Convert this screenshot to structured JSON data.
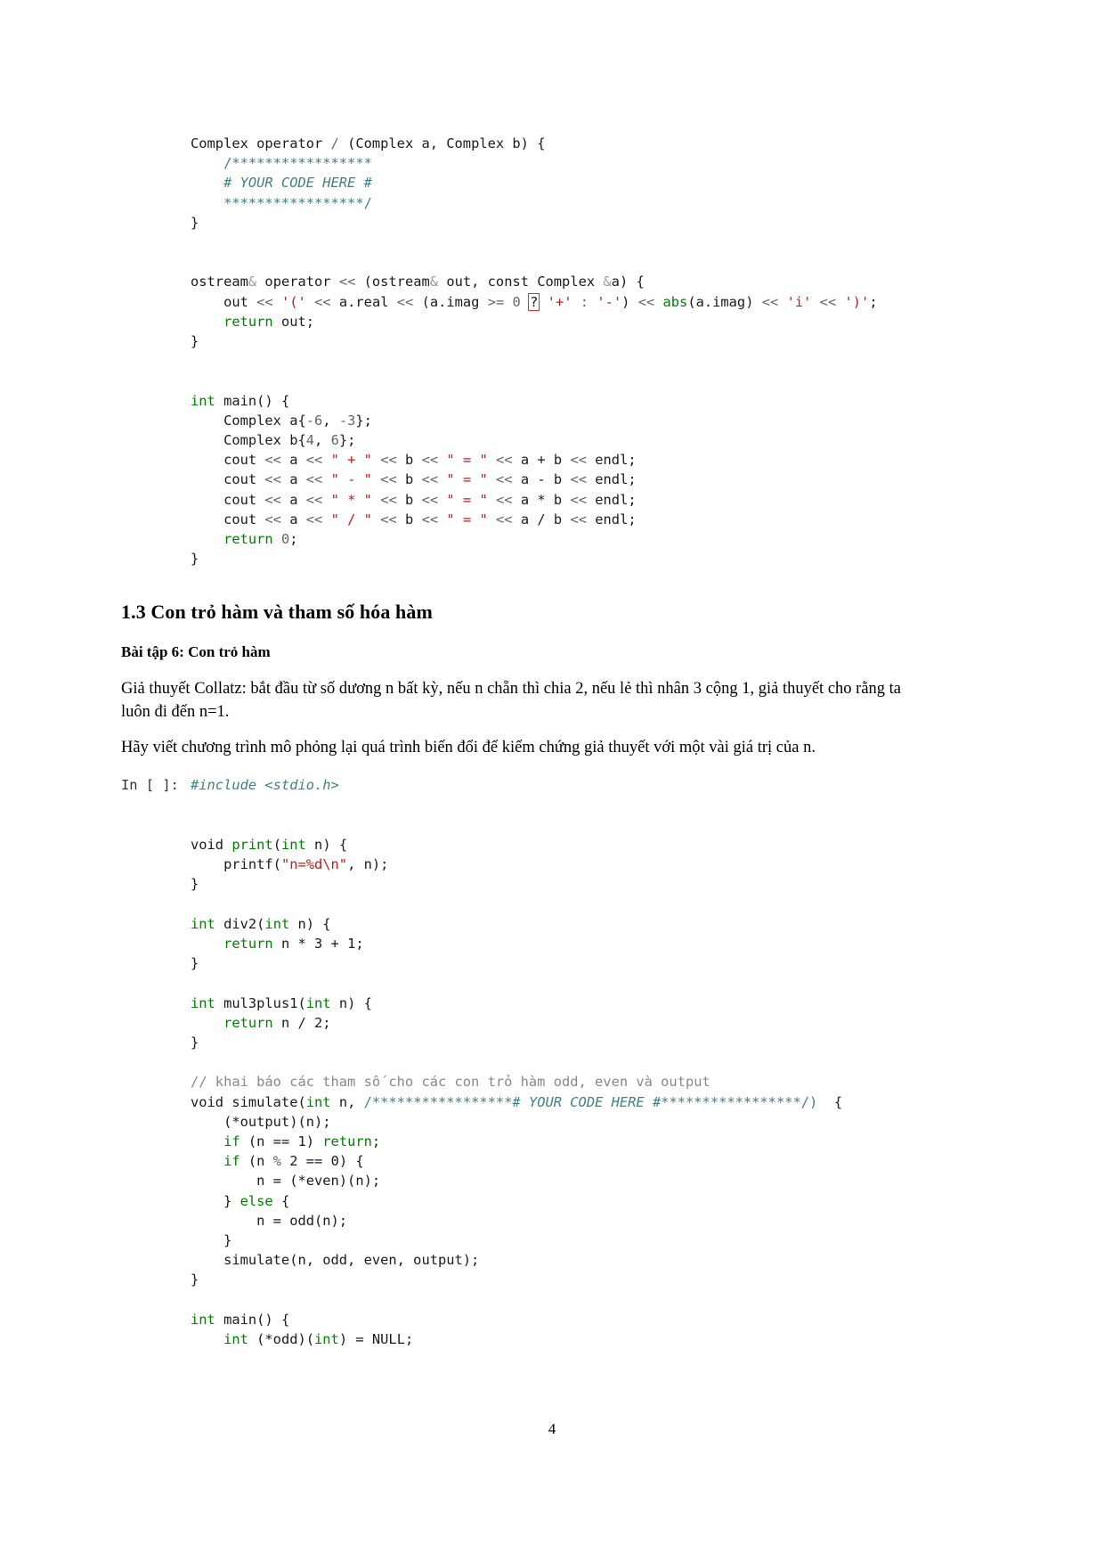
{
  "document": {
    "page_number": "4"
  },
  "code_block_1": {
    "lines": [
      "Complex operator / (Complex a, Complex b) {",
      "    /*****************",
      "    # YOUR CODE HERE #",
      "    *****************/",
      "}"
    ],
    "line1_prefix": "Complex operator ",
    "line1_slash": "/",
    "line1_suffix": " (Complex a, Complex b) {",
    "stars_open": "    /*****************",
    "your_code_here": "    # YOUR CODE HERE #",
    "stars_close": "    *****************/",
    "close_brace": "}"
  },
  "code_block_2": {
    "sig_a": "ostream",
    "sig_amp": "&",
    "sig_b": " operator ",
    "sig_shift": "<<",
    "sig_c": " (ostream",
    "sig_d": " out, const Complex ",
    "sig_e": "a) {",
    "out_indent": "    out ",
    "out_shift1": "<<",
    "out_q_paren": "'('",
    "out_areal": " a.real ",
    "out_paren_open": "(a.imag ",
    "out_gte": ">=",
    "out_zero": "0",
    "out_question": "?",
    "out_plus": "'+'",
    "out_colon": ":",
    "out_minus": "'-'",
    "out_abs": "abs",
    "out_absarg": "(a.imag)",
    "out_i": "'i'",
    "out_rparen": "')'",
    "return_kw": "return",
    "return_rest": " out;",
    "close_brace": "}"
  },
  "code_block_3": {
    "int_kw": "int",
    "main_sig": " main() {",
    "decl_a": "    Complex a{",
    "decl_a_n1": "-6",
    "decl_a_sep": ", ",
    "decl_a_n2": "-3",
    "decl_a_end": "};",
    "decl_b": "    Complex b{",
    "decl_b_n1": "4",
    "decl_b_sep": ", ",
    "decl_b_n2": "6",
    "decl_b_end": "};",
    "cout_lines": [
      {
        "op_str": "\" + \"",
        "expr_op": "+"
      },
      {
        "op_str": "\" - \"",
        "expr_op": "-"
      },
      {
        "op_str": "\" * \"",
        "expr_op": "*"
      },
      {
        "op_str": "\" / \"",
        "expr_op": "/"
      }
    ],
    "cout_prefix": "    cout ",
    "cout_shift": "<<",
    "cout_a": " a ",
    "cout_b": " b ",
    "eq_str": "\" = \"",
    "endl": " endl;",
    "return_kw": "    return",
    "return_zero": "0",
    "return_semi": ";",
    "close_brace": "}"
  },
  "headings": {
    "section_title": "1.3 Con trỏ hàm và tham số hóa hàm",
    "exercise_title": "Bài tập 6: Con trỏ hàm"
  },
  "paragraphs": {
    "p1": "Giả thuyết Collatz: bắt đầu từ số dương n bất kỳ, nếu n chẵn thì chia 2, nếu lẻ thì nhân 3 cộng 1, giả thuyết cho rằng ta luôn đi đến n=1.",
    "p2": "Hãy viết chương trình mô phỏng lại quá trình biến đổi để kiểm chứng giả thuyết với một vài giá trị của n."
  },
  "notebook_cell": {
    "prompt": "In [ ]:",
    "include_line": "#include <stdio.h>"
  },
  "code_block_4": {
    "void_print": "void ",
    "print_name": "print",
    "print_args": "(int n) {",
    "printf_indent": "    printf(",
    "printf_str": "\"n=%d\\n\"",
    "printf_rest": ", n);",
    "close_brace": "}",
    "int_kw": "int",
    "div2_sig": " div2(",
    "div2_int": "int",
    "div2_rest": " n) {",
    "div2_return": "    return",
    "div2_expr": " n * 3 + 1;",
    "mul3_sig": " mul3plus1(",
    "mul3_int": "int",
    "mul3_rest": " n) {",
    "mul3_return": "    return",
    "mul3_expr": " n / 2;",
    "comment_params": "// khai báo các tham số cho các con trỏ hàm odd, even và output",
    "sim_void": "void simulate(",
    "sim_int": "int",
    "sim_n": " n, ",
    "sim_stars_open": "/*****************",
    "sim_your_code": "# YOUR CODE HERE #",
    "sim_stars_close": "*****************/)",
    "sim_brace": "  {",
    "sim_output_call": "    (*output)(n);",
    "sim_if1_a": "    if",
    "sim_if1_b": " (n == 1) ",
    "sim_if1_return": "return",
    "sim_if1_semi": ";",
    "sim_if2_a": "    if",
    "sim_if2_b": " (n ",
    "sim_if2_mod": "%",
    "sim_if2_c": " 2 == 0) {",
    "sim_even": "        n = (*even)(n);",
    "sim_else_a": "    } ",
    "sim_else_kw": "else",
    "sim_else_b": " {",
    "sim_odd": "        n = odd(n);",
    "sim_close_if": "    }",
    "sim_recurse": "    simulate(n, odd, even, output);",
    "sim_close": "}",
    "main_int": "int",
    "main_sig": " main() {",
    "main_odd_int": "    int",
    "main_odd_a": " (*odd)(",
    "main_odd_int2": "int",
    "main_odd_b": ") = NULL;"
  },
  "colors": {
    "keyword_green": "#008000",
    "string_red": "#ba2121",
    "comment_teal": "#408080",
    "number_gray": "#666666",
    "highlight_box_red": "#e03030"
  }
}
